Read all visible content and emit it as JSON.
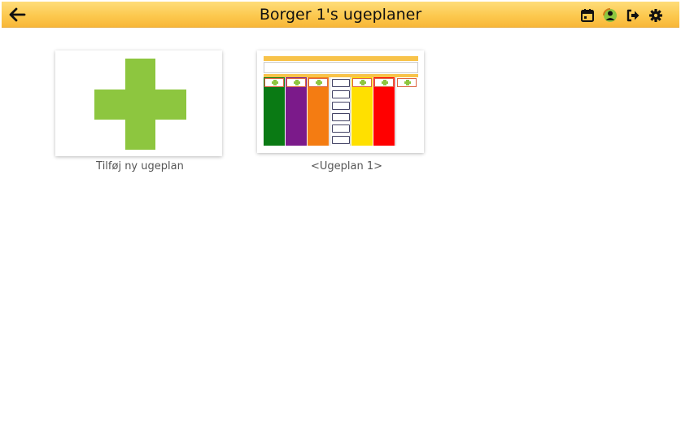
{
  "header": {
    "title": "Borger 1's ugeplaner"
  },
  "tiles": [
    {
      "caption": "Tilføj ny ugeplan",
      "icon": "plus-icon"
    },
    {
      "caption": "<Ugeplan 1>",
      "icon": "weekplan-thumbnail"
    }
  ],
  "colors": {
    "header_top": "#fedd7a",
    "header_bottom": "#f8b738",
    "plus_green": "#8dc63f",
    "day_colors": [
      "#0a7a14",
      "#7b1a8a",
      "#f47c12",
      "#ffffff",
      "#ffe000",
      "#ff0000",
      "#ffffff"
    ]
  },
  "icons": [
    "back-arrow-icon",
    "calendar-icon",
    "switch-user-icon",
    "logout-icon",
    "settings-icon"
  ]
}
